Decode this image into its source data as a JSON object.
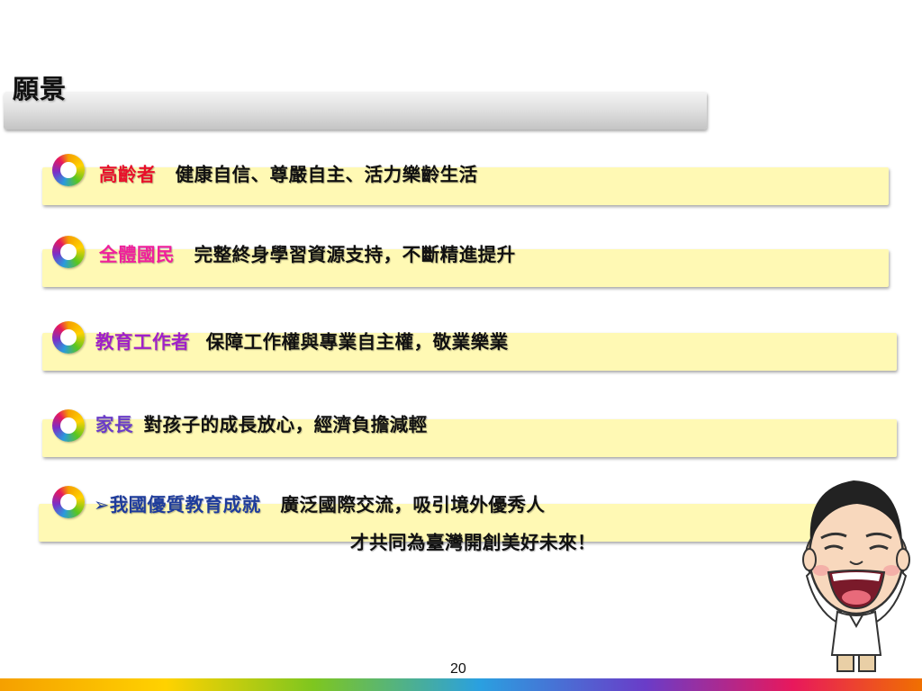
{
  "slide": {
    "title": "願景",
    "page_number": "20"
  },
  "items": [
    {
      "keyword": "高齡者",
      "desc": "健康自信、尊嚴自主、活力樂齡生活"
    },
    {
      "keyword": "全體國民",
      "desc": "完整終身學習資源支持，不斷精進提升"
    },
    {
      "keyword": "教育工作者",
      "desc": "保障工作權與專業自主權，敬業樂業"
    },
    {
      "keyword": "家長",
      "desc": "對孩子的成長放心，經濟負擔減輕"
    },
    {
      "bullet": "➢",
      "keyword": "我國優質教育成就",
      "desc": "廣泛國際交流，吸引境外優秀人",
      "desc_line2": "才共同為臺灣開創美好未來！"
    }
  ],
  "colors": {
    "band": "#fff9b4",
    "keyword_1": "#e8102a",
    "keyword_2": "#f0209c",
    "keyword_3": "#a020c8",
    "keyword_4": "#6a3cc8",
    "keyword_5": "#1e3c9c"
  },
  "icons": [
    "rainbow-ring-icon",
    "cartoon-mascot-icon"
  ]
}
